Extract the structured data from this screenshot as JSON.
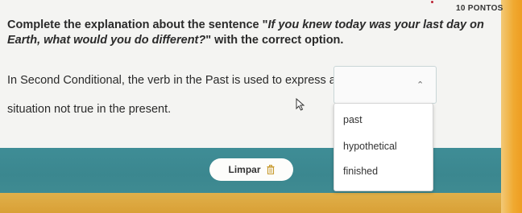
{
  "header": {
    "points_label": "10 PONTOS"
  },
  "question": {
    "prefix": "Complete the explanation about the sentence \"",
    "quote": "If you knew today was your last day on Earth, what would you do different?",
    "suffix": "\" with the correct option."
  },
  "body": {
    "line1": "In Second Conditional, the verb in the Past is used to express a",
    "line2": "situation not true in the present."
  },
  "dropdown": {
    "selected_value": "",
    "options": [
      "past",
      "hypothetical",
      "finished"
    ]
  },
  "footer": {
    "clear_label": "Limpar"
  },
  "colors": {
    "teal": "#3f8d96",
    "orange": "#f0a930"
  },
  "icons": {
    "clear": "trash-icon",
    "dropdown": "chevron-up-icon",
    "cursor": "mouse-pointer-icon"
  }
}
